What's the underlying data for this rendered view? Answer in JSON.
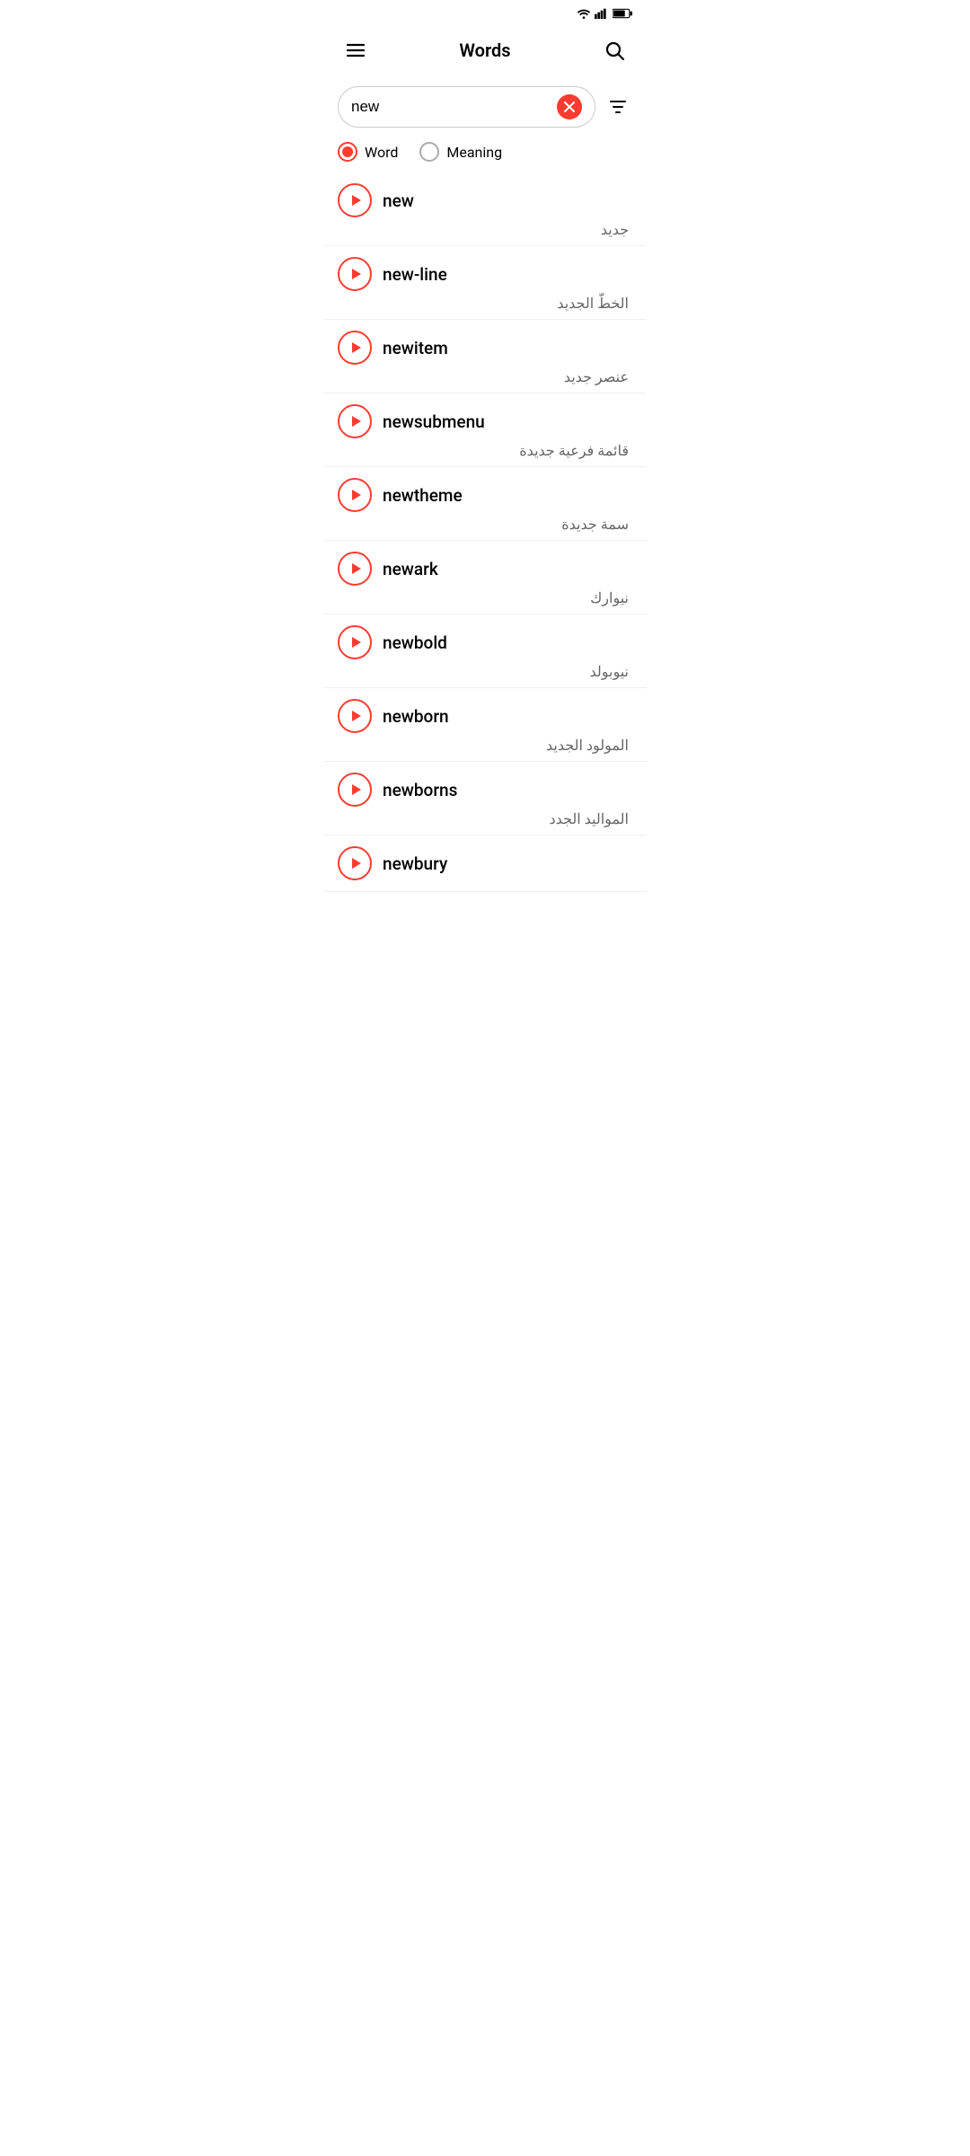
{
  "statusBar": {
    "wifi": "wifi",
    "signal": "signal",
    "battery": "battery"
  },
  "header": {
    "menuIcon": "menu-icon",
    "title": "Words",
    "searchIcon": "search-icon"
  },
  "searchBar": {
    "value": "new",
    "placeholder": "Search",
    "clearIcon": "clear-icon",
    "filterIcon": "filter-icon"
  },
  "filterTabs": [
    {
      "id": "word",
      "label": "Word",
      "selected": true
    },
    {
      "id": "meaning",
      "label": "Meaning",
      "selected": false
    }
  ],
  "words": [
    {
      "word": "new",
      "meaning": "جديد"
    },
    {
      "word": "new-line",
      "meaning": "الخطّ الجديد"
    },
    {
      "word": "newitem",
      "meaning": "عنصر جديد"
    },
    {
      "word": "newsubmenu",
      "meaning": "قائمة فرعية جديدة"
    },
    {
      "word": "newtheme",
      "meaning": "سمة جديدة"
    },
    {
      "word": "newark",
      "meaning": "نيوارك"
    },
    {
      "word": "newbold",
      "meaning": "نيوبولد"
    },
    {
      "word": "newborn",
      "meaning": "المولود الجديد"
    },
    {
      "word": "newborns",
      "meaning": "المواليد الجدد"
    },
    {
      "word": "newbury",
      "meaning": ""
    }
  ]
}
